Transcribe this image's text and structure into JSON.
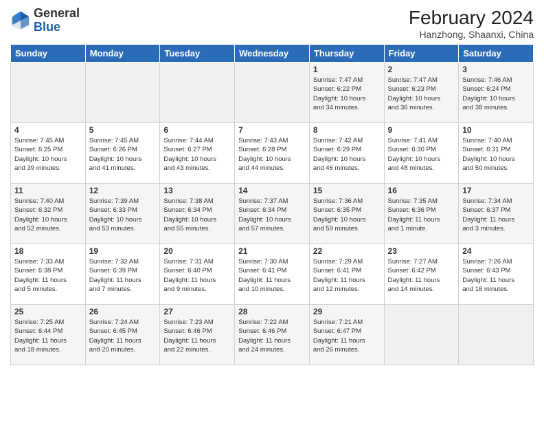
{
  "logo": {
    "line1": "General",
    "line2": "Blue"
  },
  "title": "February 2024",
  "location": "Hanzhong, Shaanxi, China",
  "days_of_week": [
    "Sunday",
    "Monday",
    "Tuesday",
    "Wednesday",
    "Thursday",
    "Friday",
    "Saturday"
  ],
  "weeks": [
    [
      {
        "day": "",
        "info": ""
      },
      {
        "day": "",
        "info": ""
      },
      {
        "day": "",
        "info": ""
      },
      {
        "day": "",
        "info": ""
      },
      {
        "day": "1",
        "info": "Sunrise: 7:47 AM\nSunset: 6:22 PM\nDaylight: 10 hours\nand 34 minutes."
      },
      {
        "day": "2",
        "info": "Sunrise: 7:47 AM\nSunset: 6:23 PM\nDaylight: 10 hours\nand 36 minutes."
      },
      {
        "day": "3",
        "info": "Sunrise: 7:46 AM\nSunset: 6:24 PM\nDaylight: 10 hours\nand 38 minutes."
      }
    ],
    [
      {
        "day": "4",
        "info": "Sunrise: 7:45 AM\nSunset: 6:25 PM\nDaylight: 10 hours\nand 39 minutes."
      },
      {
        "day": "5",
        "info": "Sunrise: 7:45 AM\nSunset: 6:26 PM\nDaylight: 10 hours\nand 41 minutes."
      },
      {
        "day": "6",
        "info": "Sunrise: 7:44 AM\nSunset: 6:27 PM\nDaylight: 10 hours\nand 43 minutes."
      },
      {
        "day": "7",
        "info": "Sunrise: 7:43 AM\nSunset: 6:28 PM\nDaylight: 10 hours\nand 44 minutes."
      },
      {
        "day": "8",
        "info": "Sunrise: 7:42 AM\nSunset: 6:29 PM\nDaylight: 10 hours\nand 46 minutes."
      },
      {
        "day": "9",
        "info": "Sunrise: 7:41 AM\nSunset: 6:30 PM\nDaylight: 10 hours\nand 48 minutes."
      },
      {
        "day": "10",
        "info": "Sunrise: 7:40 AM\nSunset: 6:31 PM\nDaylight: 10 hours\nand 50 minutes."
      }
    ],
    [
      {
        "day": "11",
        "info": "Sunrise: 7:40 AM\nSunset: 6:32 PM\nDaylight: 10 hours\nand 52 minutes."
      },
      {
        "day": "12",
        "info": "Sunrise: 7:39 AM\nSunset: 6:33 PM\nDaylight: 10 hours\nand 53 minutes."
      },
      {
        "day": "13",
        "info": "Sunrise: 7:38 AM\nSunset: 6:34 PM\nDaylight: 10 hours\nand 55 minutes."
      },
      {
        "day": "14",
        "info": "Sunrise: 7:37 AM\nSunset: 6:34 PM\nDaylight: 10 hours\nand 57 minutes."
      },
      {
        "day": "15",
        "info": "Sunrise: 7:36 AM\nSunset: 6:35 PM\nDaylight: 10 hours\nand 59 minutes."
      },
      {
        "day": "16",
        "info": "Sunrise: 7:35 AM\nSunset: 6:36 PM\nDaylight: 11 hours\nand 1 minute."
      },
      {
        "day": "17",
        "info": "Sunrise: 7:34 AM\nSunset: 6:37 PM\nDaylight: 11 hours\nand 3 minutes."
      }
    ],
    [
      {
        "day": "18",
        "info": "Sunrise: 7:33 AM\nSunset: 6:38 PM\nDaylight: 11 hours\nand 5 minutes."
      },
      {
        "day": "19",
        "info": "Sunrise: 7:32 AM\nSunset: 6:39 PM\nDaylight: 11 hours\nand 7 minutes."
      },
      {
        "day": "20",
        "info": "Sunrise: 7:31 AM\nSunset: 6:40 PM\nDaylight: 11 hours\nand 9 minutes."
      },
      {
        "day": "21",
        "info": "Sunrise: 7:30 AM\nSunset: 6:41 PM\nDaylight: 11 hours\nand 10 minutes."
      },
      {
        "day": "22",
        "info": "Sunrise: 7:29 AM\nSunset: 6:41 PM\nDaylight: 11 hours\nand 12 minutes."
      },
      {
        "day": "23",
        "info": "Sunrise: 7:27 AM\nSunset: 6:42 PM\nDaylight: 11 hours\nand 14 minutes."
      },
      {
        "day": "24",
        "info": "Sunrise: 7:26 AM\nSunset: 6:43 PM\nDaylight: 11 hours\nand 16 minutes."
      }
    ],
    [
      {
        "day": "25",
        "info": "Sunrise: 7:25 AM\nSunset: 6:44 PM\nDaylight: 11 hours\nand 18 minutes."
      },
      {
        "day": "26",
        "info": "Sunrise: 7:24 AM\nSunset: 6:45 PM\nDaylight: 11 hours\nand 20 minutes."
      },
      {
        "day": "27",
        "info": "Sunrise: 7:23 AM\nSunset: 6:46 PM\nDaylight: 11 hours\nand 22 minutes."
      },
      {
        "day": "28",
        "info": "Sunrise: 7:22 AM\nSunset: 6:46 PM\nDaylight: 11 hours\nand 24 minutes."
      },
      {
        "day": "29",
        "info": "Sunrise: 7:21 AM\nSunset: 6:47 PM\nDaylight: 11 hours\nand 26 minutes."
      },
      {
        "day": "",
        "info": ""
      },
      {
        "day": "",
        "info": ""
      }
    ]
  ]
}
